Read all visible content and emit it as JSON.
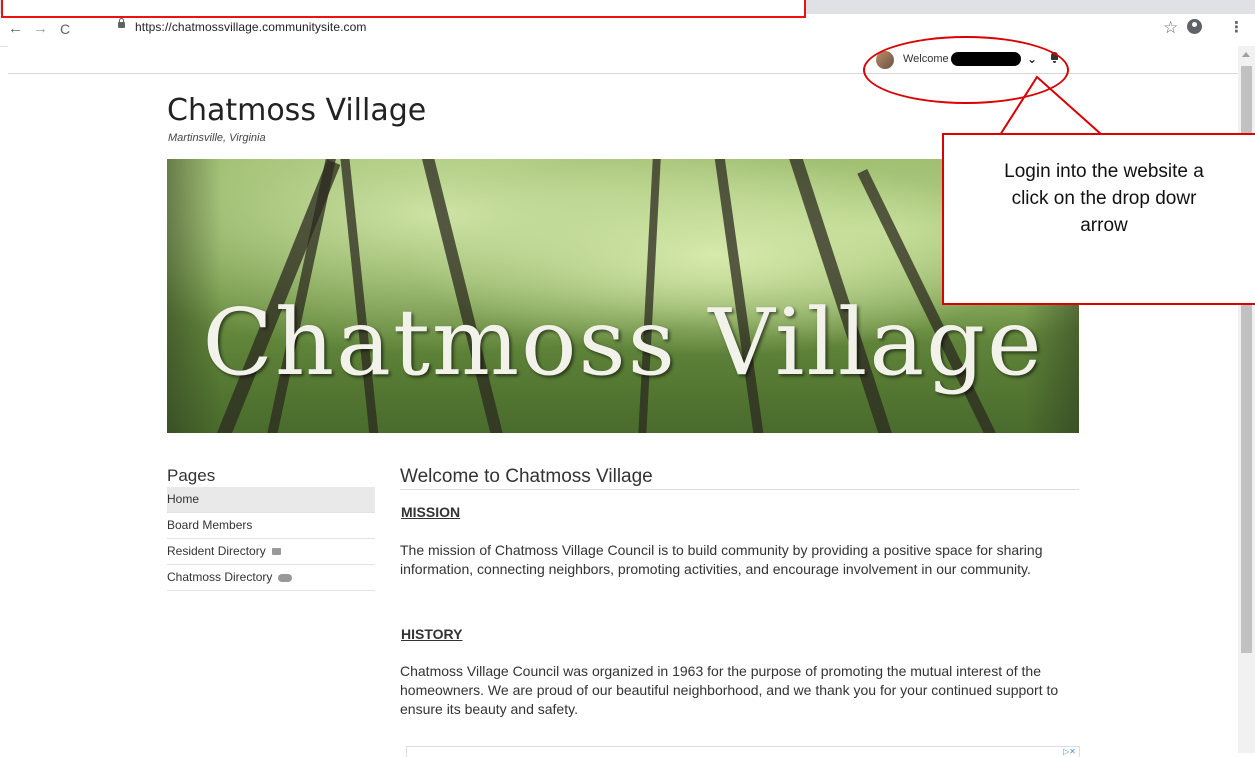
{
  "browser": {
    "url": "https://chatmossvillage.communitysite.com",
    "back_icon": "arrow-left-icon",
    "forward_icon": "arrow-right-icon",
    "reload_icon": "reload-icon",
    "back": "←",
    "forward": "→",
    "reload": "C",
    "star": "☆",
    "menu": "⋮"
  },
  "site_header": {
    "welcome": "Welcome",
    "chevron": "⌄",
    "bell_icon": "bell-icon"
  },
  "site": {
    "title": "Chatmoss Village",
    "subtitle": "Martinsville, Virginia",
    "banner_text": "Chatmoss Village"
  },
  "sidebar": {
    "title": "Pages",
    "items": [
      {
        "label": "Home",
        "active": true
      },
      {
        "label": "Board Members"
      },
      {
        "label": "Resident Directory",
        "icon": "lock-icon"
      },
      {
        "label": "Chatmoss Directory",
        "icon": "cloud-icon"
      }
    ]
  },
  "main": {
    "title": "Welcome to Chatmoss Village",
    "mission_heading": "MISSION",
    "mission_text": "The mission of Chatmoss Village Council is to build community by providing a positive space for sharing information, connecting neighbors, promoting activities, and encourage involvement in our community.",
    "history_heading": "HISTORY",
    "history_text": "Chatmoss Village Council was organized in 1963 for the purpose of promoting the mutual interest of the homeowners. We are proud of our beautiful neighborhood, and we thank you for your continued support to ensure its beauty and safety."
  },
  "annotation": {
    "callout_line1": "Login into the website a",
    "callout_line2": "click on the drop dowr",
    "callout_line3": "arrow",
    "color": "#dd0000"
  }
}
